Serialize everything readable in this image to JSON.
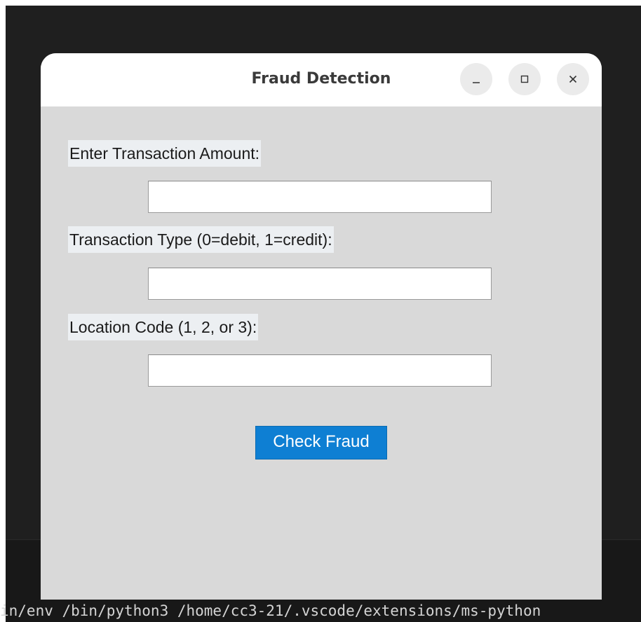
{
  "window": {
    "title": "Fraud Detection",
    "controls": {
      "minimize_icon": "minimize-icon",
      "maximize_icon": "maximize-icon",
      "close_icon": "close-icon"
    }
  },
  "form": {
    "amount_label": "Enter Transaction Amount:",
    "amount_value": "",
    "type_label": "Transaction Type (0=debit, 1=credit):",
    "type_value": "",
    "location_label": "Location Code (1, 2, or 3):",
    "location_value": "",
    "submit_label": "Check Fraud"
  },
  "terminal": {
    "command_text": "in/env /bin/python3 /home/cc3-21/.vscode/extensions/ms-python"
  },
  "colors": {
    "window_bg": "#d9d9d9",
    "titlebar_bg": "#ffffff",
    "button_accent": "#0e7fd3",
    "desktop_bg": "#1f1f1f"
  }
}
